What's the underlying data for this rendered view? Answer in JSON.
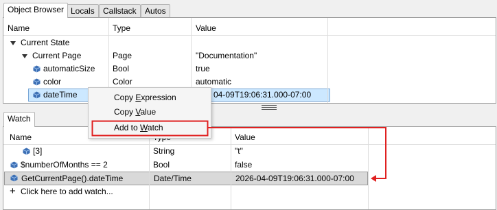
{
  "top_tabs": [
    "Object Browser",
    "Locals",
    "Callstack",
    "Autos"
  ],
  "object_browser": {
    "columns": [
      "Name",
      "Type",
      "Value"
    ],
    "rows": [
      {
        "name": "Current State",
        "type": "",
        "value": "",
        "icon": "expanded-triangle-icon"
      },
      {
        "name": "Current Page",
        "type": "Page",
        "value": "\"Documentation\"",
        "icon": "expanded-triangle-icon"
      },
      {
        "name": "automaticSize",
        "type": "Bool",
        "value": "true",
        "icon": "object-cube-icon"
      },
      {
        "name": "color",
        "type": "Color",
        "value": "automatic",
        "icon": "object-cube-icon"
      },
      {
        "name": "dateTime",
        "type": "",
        "value": "04-09T19:06:31.000-07:00",
        "icon": "object-cube-icon",
        "selected": true
      }
    ]
  },
  "context_menu": {
    "items": [
      {
        "prefix": "Copy ",
        "underline": "E",
        "rest": "xpression"
      },
      {
        "prefix": "Copy ",
        "underline": "V",
        "rest": "alue"
      },
      {
        "prefix": "Add to ",
        "underline": "W",
        "rest": "atch",
        "highlighted": true
      }
    ]
  },
  "watch_tab": "Watch",
  "watch": {
    "columns": [
      "Name",
      "Type",
      "Value"
    ],
    "rows": [
      {
        "name": "[3]",
        "type": "String",
        "value": "\"t\""
      },
      {
        "name": "$numberOfMonths == 2",
        "type": "Bool",
        "value": "false"
      },
      {
        "name": "GetCurrentPage().dateTime",
        "type": "Date/Time",
        "value": "2026-04-09T19:06:31.000-07:00",
        "selected": true
      }
    ],
    "add_label": "Click here to add watch..."
  },
  "colors": {
    "annotation_red": "#e02020",
    "selection_bg": "#cce8ff",
    "watch_selected_bg": "#d9d9d9"
  }
}
